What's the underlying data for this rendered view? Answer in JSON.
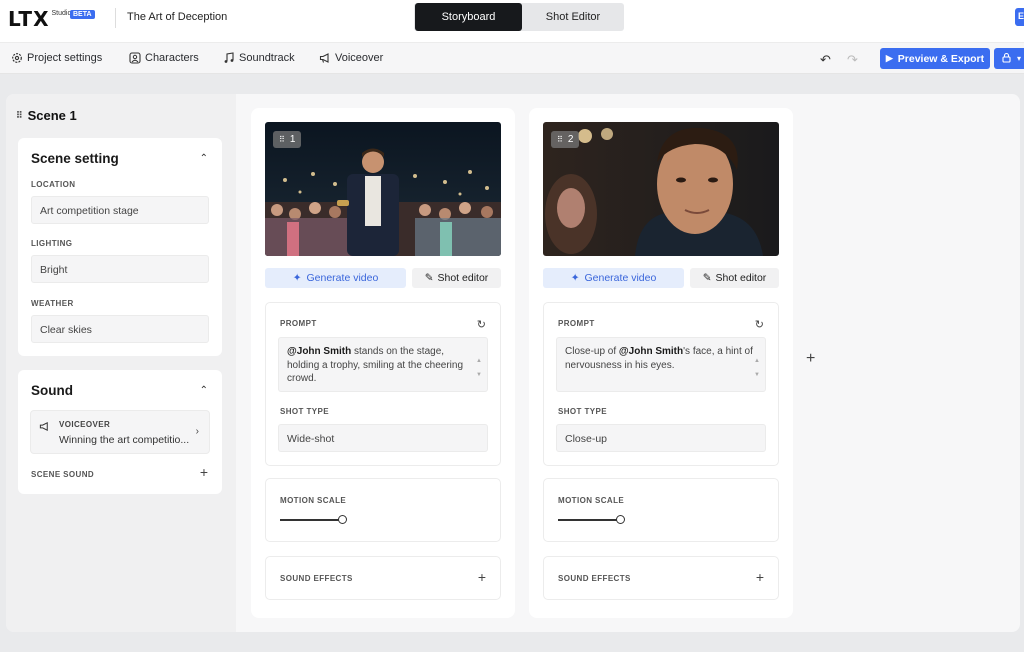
{
  "brand": {
    "logo": "LTX",
    "sub": "Studio",
    "badge": "BETA"
  },
  "project": {
    "title": "The Art of Deception"
  },
  "modes": {
    "active": "Storyboard",
    "inactive": "Shot Editor"
  },
  "topright": {
    "initial": "E"
  },
  "toolbar": {
    "project_settings": "Project settings",
    "characters": "Characters",
    "soundtrack": "Soundtrack",
    "voiceover": "Voiceover",
    "preview_export": "Preview & Export"
  },
  "scene": {
    "title": "Scene 1",
    "setting": {
      "title": "Scene setting",
      "location_label": "LOCATION",
      "location_value": "Art competition stage",
      "lighting_label": "LIGHTING",
      "lighting_value": "Bright",
      "weather_label": "WEATHER",
      "weather_value": "Clear skies"
    },
    "sound": {
      "title": "Sound",
      "voiceover_label": "VOICEOVER",
      "voiceover_text": "Winning the art competitio...",
      "scene_sound_label": "SCENE SOUND"
    }
  },
  "shots": [
    {
      "number": "1",
      "generate_label": "Generate video",
      "editor_label": "Shot editor",
      "prompt_label": "PROMPT",
      "prompt_mention": "@John Smith",
      "prompt_text": " stands on the stage, holding a trophy, smiling at the cheering crowd.",
      "shot_type_label": "SHOT TYPE",
      "shot_type_value": "Wide-shot",
      "motion_label": "MOTION SCALE",
      "motion_value": 0.72,
      "sfx_label": "SOUND EFFECTS"
    },
    {
      "number": "2",
      "generate_label": "Generate video",
      "editor_label": "Shot editor",
      "prompt_label": "PROMPT",
      "prompt_prefix": "Close-up of ",
      "prompt_mention": "@John Smith",
      "prompt_text": "'s face, a hint of nervousness in his eyes.",
      "shot_type_label": "SHOT TYPE",
      "shot_type_value": "Close-up",
      "motion_label": "MOTION SCALE",
      "motion_value": 0.72,
      "sfx_label": "SOUND EFFECTS"
    }
  ],
  "colors": {
    "accent": "#3b6df0",
    "dark": "#17191c",
    "panel": "#f0f0f1"
  }
}
